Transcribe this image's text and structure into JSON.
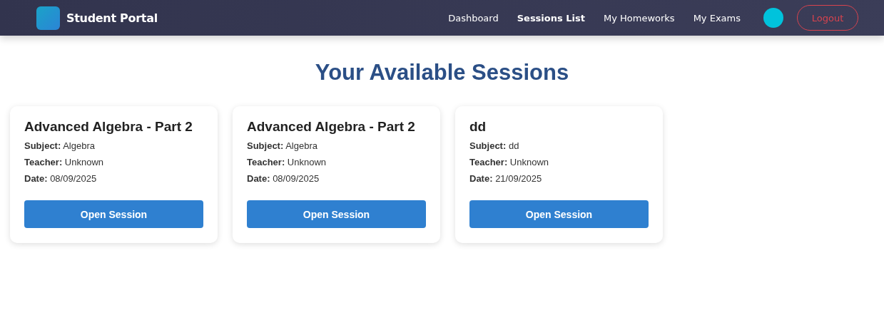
{
  "navbar": {
    "brand": "Student Portal",
    "links": [
      {
        "label": "Dashboard",
        "selected": false
      },
      {
        "label": "Sessions List",
        "selected": true
      },
      {
        "label": "My Homeworks",
        "selected": false
      },
      {
        "label": "My Exams",
        "selected": false
      }
    ],
    "logout": "Logout"
  },
  "heading": "Your Available Sessions",
  "sessions": [
    {
      "title": "Advanced Algebra - Part 2",
      "fields": [
        {
          "label": "Subject:",
          "value": "Algebra"
        },
        {
          "label": "Teacher:",
          "value": "Unknown"
        },
        {
          "label": "Date:",
          "value": "08/09/2025"
        }
      ],
      "button": "Open Session"
    },
    {
      "title": "Advanced Algebra - Part 2",
      "fields": [
        {
          "label": "Subject:",
          "value": "Algebra"
        },
        {
          "label": "Teacher:",
          "value": "Unknown"
        },
        {
          "label": "Date:",
          "value": "08/09/2025"
        }
      ],
      "button": "Open Session"
    },
    {
      "title": "dd",
      "fields": [
        {
          "label": "Subject:",
          "value": "dd"
        },
        {
          "label": "Teacher:",
          "value": "Unknown"
        },
        {
          "label": "Date:",
          "value": "21/09/2025"
        }
      ],
      "button": "Open Session"
    }
  ]
}
